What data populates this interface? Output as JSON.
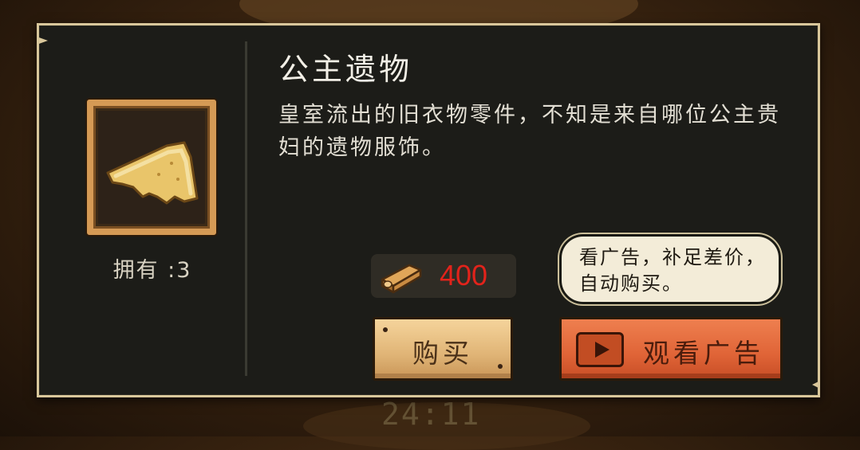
{
  "item": {
    "title": "公主遗物",
    "description": "皇室流出的旧衣物零件，不知是来自哪位公主贵妇的遗物服饰。",
    "owned_label": "拥有 :3",
    "icon": "fabric-scrap-icon"
  },
  "price": {
    "icon": "wood-log-icon",
    "value": "400",
    "color": "#e2231b"
  },
  "ad_hint": {
    "text": "看广告，补足差价，自动购买。"
  },
  "buttons": {
    "buy_label": "购买",
    "watch_ad_label": "观看广告"
  },
  "background": {
    "timer": "24:11"
  }
}
